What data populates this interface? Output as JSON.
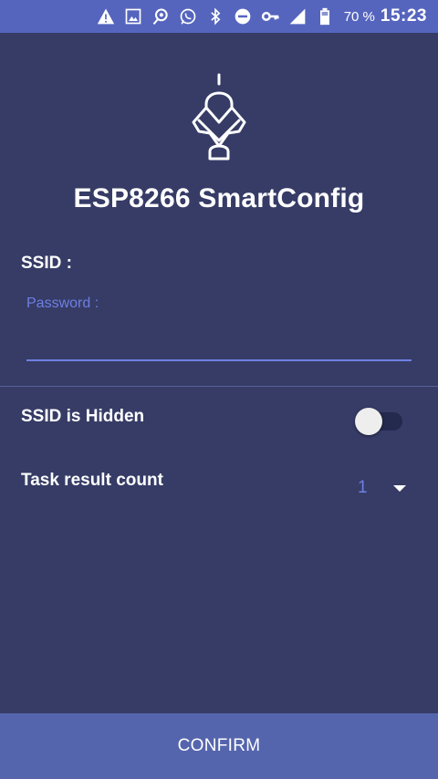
{
  "status_bar": {
    "icons": [
      "warning-icon",
      "image-icon",
      "location-icon",
      "whatsapp-icon",
      "bluetooth-icon",
      "do-not-disturb-icon",
      "key-icon",
      "signal-icon",
      "battery-icon"
    ],
    "battery_percent": "70 %",
    "time": "15:23"
  },
  "app": {
    "title": "ESP8266 SmartConfig",
    "logo_icon": "esp-robot-icon"
  },
  "form": {
    "ssid_label": "SSID :",
    "password_hint": "Password :",
    "password_value": "",
    "hidden_label": "SSID is Hidden",
    "hidden_on": false,
    "count_label": "Task result count",
    "count_value": "1",
    "confirm_label": "CONFIRM"
  },
  "colors": {
    "background": "#363c66",
    "status_bar": "#5565be",
    "accent": "#6f7fe3",
    "button": "#5565ad"
  }
}
